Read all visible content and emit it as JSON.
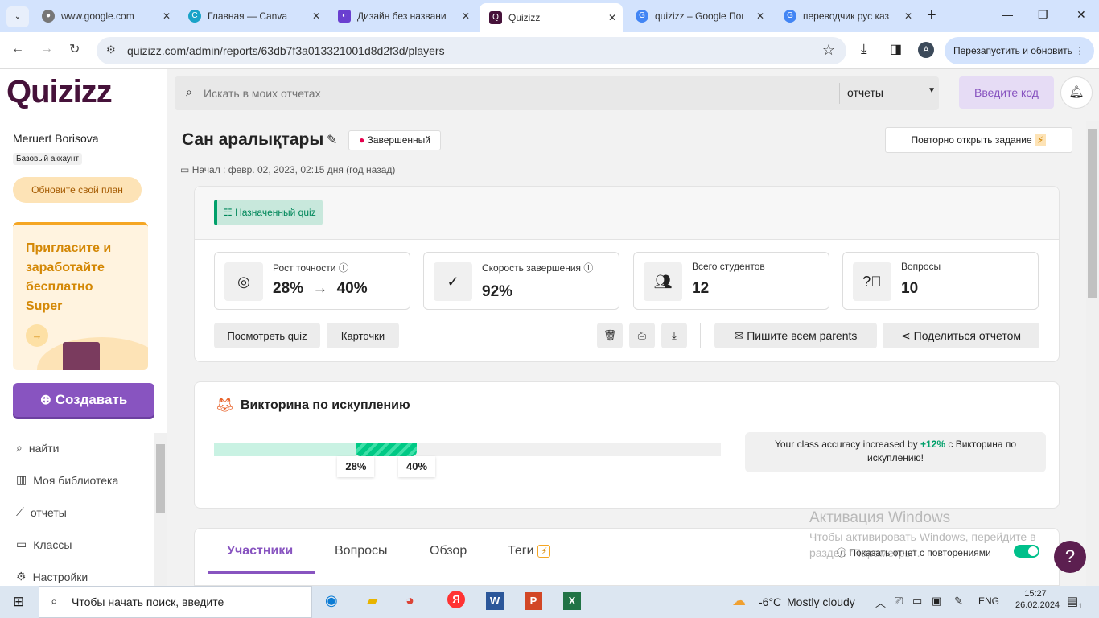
{
  "browser": {
    "tabs": [
      {
        "label": "www.google.com"
      },
      {
        "label": "Главная — Canva"
      },
      {
        "label": "Дизайн без названи"
      },
      {
        "label": "Quizizz"
      },
      {
        "label": "quizizz – Google Пои"
      },
      {
        "label": "переводчик рус каз"
      }
    ],
    "url": "quizizz.com/admin/reports/63db7f3a013321001d8d2f3d/players",
    "profile": "A",
    "relaunch": "Перезапустить и обновить"
  },
  "sidebar": {
    "logo": "Quizizz",
    "user": "Meruert Borisova",
    "account": "Базовый аккаунт",
    "upgrade": "Обновите свой план",
    "promo": "Пригласите и заработайте бесплатно Super",
    "create": "Создавать",
    "items": [
      {
        "label": "найти"
      },
      {
        "label": "Моя библиотека"
      },
      {
        "label": "отчеты"
      },
      {
        "label": "Классы"
      },
      {
        "label": "Настройки"
      }
    ]
  },
  "header": {
    "search_placeholder": "Искать в моих отчетах",
    "scope": "отчеты",
    "code": "Введите код"
  },
  "report": {
    "title": "Сан аралықтары",
    "status": "Завершенный",
    "reopen": "Повторно открыть задание",
    "start_label": "Начал :",
    "start": "февр. 02, 2023, 02:15 дня (год назад)",
    "type": "Назначенный quiz",
    "stats": [
      {
        "label": "Рост точности",
        "from": "28%",
        "to": "40%"
      },
      {
        "label": "Скорость завершения",
        "value": "92%"
      },
      {
        "label": "Всего студентов",
        "value": "12"
      },
      {
        "label": "Вопросы",
        "value": "10"
      }
    ],
    "view_quiz": "Посмотреть quiz",
    "cards": "Карточки",
    "email": "Пишите всем parents",
    "share": "Поделиться отчетом"
  },
  "redemption": {
    "title": "Викторина по искуплению",
    "from": 28,
    "to": 40,
    "from_label": "28%",
    "to_label": "40%",
    "msg_pre": "Your class accuracy increased by",
    "msg_delta": "+12%",
    "msg_post": "с Викторина по искуплению!"
  },
  "tabs": [
    {
      "label": "Участники"
    },
    {
      "label": "Вопросы"
    },
    {
      "label": "Обзор"
    },
    {
      "label": "Теги"
    }
  ],
  "toggle_label": "Показать отчет с повторениями",
  "toggle_on": true,
  "watermark": {
    "title": "Активация Windows",
    "text": "Чтобы активировать Windows, перейдите в раздел \"Параметры\"."
  },
  "taskbar": {
    "search": "Чтобы начать поиск, введите",
    "temp": "-6°C",
    "weather": "Mostly cloudy",
    "lang": "ENG",
    "time": "15:27",
    "date": "26.02.2024",
    "notif": "1"
  }
}
